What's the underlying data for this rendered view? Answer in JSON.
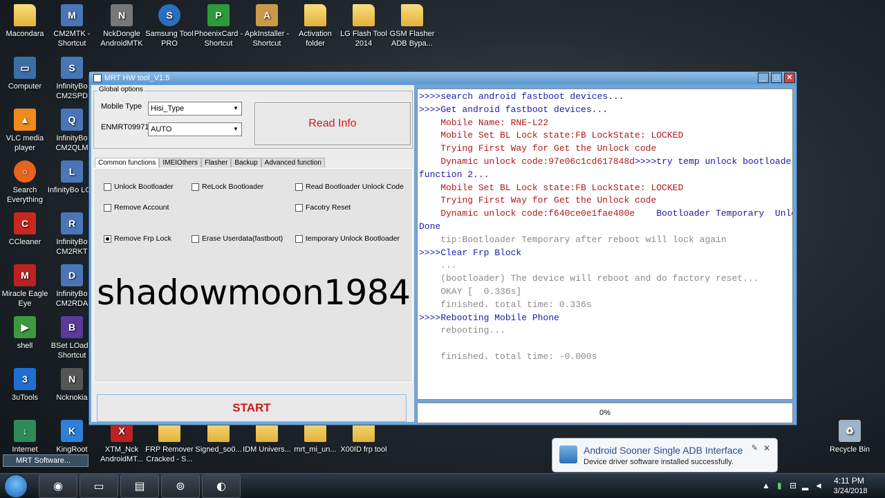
{
  "desktop": {
    "icons": [
      {
        "label": "Macondara"
      },
      {
        "label": "CM2MTK - Shortcut"
      },
      {
        "label": "NckDongle AndroidMTK"
      },
      {
        "label": "Samsung Tool PRO"
      },
      {
        "label": "PhoenixCard - Shortcut"
      },
      {
        "label": "ApkInstaller - Shortcut"
      },
      {
        "label": "Activation folder"
      },
      {
        "label": "LG Flash Tool 2014"
      },
      {
        "label": "GSM Flasher ADB Bypa..."
      },
      {
        "label": "Computer"
      },
      {
        "label": "InfinityBo CM2SPD"
      },
      {
        "label": "VLC media player"
      },
      {
        "label": "InfinityBo CM2QLM"
      },
      {
        "label": "Search Everything"
      },
      {
        "label": "InfinityBo LGS"
      },
      {
        "label": "CCleaner"
      },
      {
        "label": "InfinityBo CM2RKT"
      },
      {
        "label": "Miracle Eagle Eye"
      },
      {
        "label": "InfinityBo CM2RDA"
      },
      {
        "label": "shell"
      },
      {
        "label": "BSet LOad - Shortcut"
      },
      {
        "label": "3uTools"
      },
      {
        "label": "Ncknokia"
      },
      {
        "label": "Internet Downlo..."
      },
      {
        "label": "KingRoot"
      },
      {
        "label": "XTM_Nck AndroidMT..."
      },
      {
        "label": "FRP Remover Cracked - S..."
      },
      {
        "label": "Signed_so0..."
      },
      {
        "label": "IDM Univers..."
      },
      {
        "label": "mrt_mi_un..."
      },
      {
        "label": "X00ID frp tool"
      },
      {
        "label": "Recycle Bin"
      }
    ]
  },
  "window": {
    "title": "MRT HW tool_V1.5",
    "global_options_legend": "Global options",
    "mobile_type_label": "Mobile Type",
    "mobile_type_value": "Hisi_Type",
    "enmrt_label": "ENMRT09971",
    "enmrt_value": "AUTO",
    "read_info_label": "Read Info",
    "tabs": [
      {
        "label": "Common functions"
      },
      {
        "label": "IMEIOthers"
      },
      {
        "label": "Flasher"
      },
      {
        "label": "Backup"
      },
      {
        "label": "Advanced function"
      }
    ],
    "checkboxes": [
      {
        "label": "Unlock Bootloader",
        "checked": false
      },
      {
        "label": "ReLock Bootloader",
        "checked": false
      },
      {
        "label": "Read Bootloader Unlock Code",
        "checked": false
      },
      {
        "label": "Remove Account",
        "checked": false
      },
      {
        "label": "Facotry Reset",
        "checked": false
      },
      {
        "label": "Remove Frp Lock",
        "checked": true
      },
      {
        "label": "Erase Userdata(fastboot)",
        "checked": false
      },
      {
        "label": "temporary Unlock Bootloader",
        "checked": false
      }
    ],
    "watermark": "shadowmoon1984",
    "start_label": "START",
    "progress_label": "0%",
    "log_lines": [
      {
        "text": ">>>>search android fastboot devices...",
        "color": "blue"
      },
      {
        "text": ">>>>Get android fastboot devices...",
        "color": "blue"
      },
      {
        "text": "    Mobile Name: RNE-L22",
        "color": "red"
      },
      {
        "text": "    Mobile Set BL Lock state:FB LockState: LOCKED",
        "color": "red"
      },
      {
        "text": "    Trying First Way for Get the Unlock code",
        "color": "red"
      },
      {
        "text": "    Dynamic unlock code:97e06c1cd617848d",
        "color": "red",
        "tail": ">>>>try temp unlock bootloader",
        "tail_color": "blue"
      },
      {
        "text": "function 2...",
        "color": "blue"
      },
      {
        "text": "    Mobile Set BL Lock state:FB LockState: LOCKED",
        "color": "red"
      },
      {
        "text": "    Trying First Way for Get the Unlock code",
        "color": "red"
      },
      {
        "text": "    Dynamic unlock code:f640ce0e1fae400e",
        "color": "red",
        "tail": "    Bootloader Temporary  Unlock",
        "tail_color": "blue"
      },
      {
        "text": "Done",
        "color": "blue"
      },
      {
        "text": "    tip:Bootloader Temporary after reboot will lock again",
        "color": "gray"
      },
      {
        "text": ">>>>Clear Frp Block",
        "color": "blue"
      },
      {
        "text": "    ...",
        "color": "gray"
      },
      {
        "text": "    (bootloader) The device will reboot and do factory reset...",
        "color": "gray"
      },
      {
        "text": "    OKAY [  0.336s]",
        "color": "gray"
      },
      {
        "text": "    finished. total time: 0.336s",
        "color": "gray"
      },
      {
        "text": ">>>>Rebooting Mobile Phone",
        "color": "blue"
      },
      {
        "text": "    rebooting...",
        "color": "gray"
      },
      {
        "text": "",
        "color": "gray"
      },
      {
        "text": "    finished. total time: -0.000s",
        "color": "gray"
      }
    ]
  },
  "notification": {
    "title": "Android Sooner Single ADB Interface",
    "body": "Device driver software installed successfully."
  },
  "taskbar": {
    "minimized_window": "MRT Software...",
    "time": "4:11 PM",
    "date": "3/24/2018"
  }
}
